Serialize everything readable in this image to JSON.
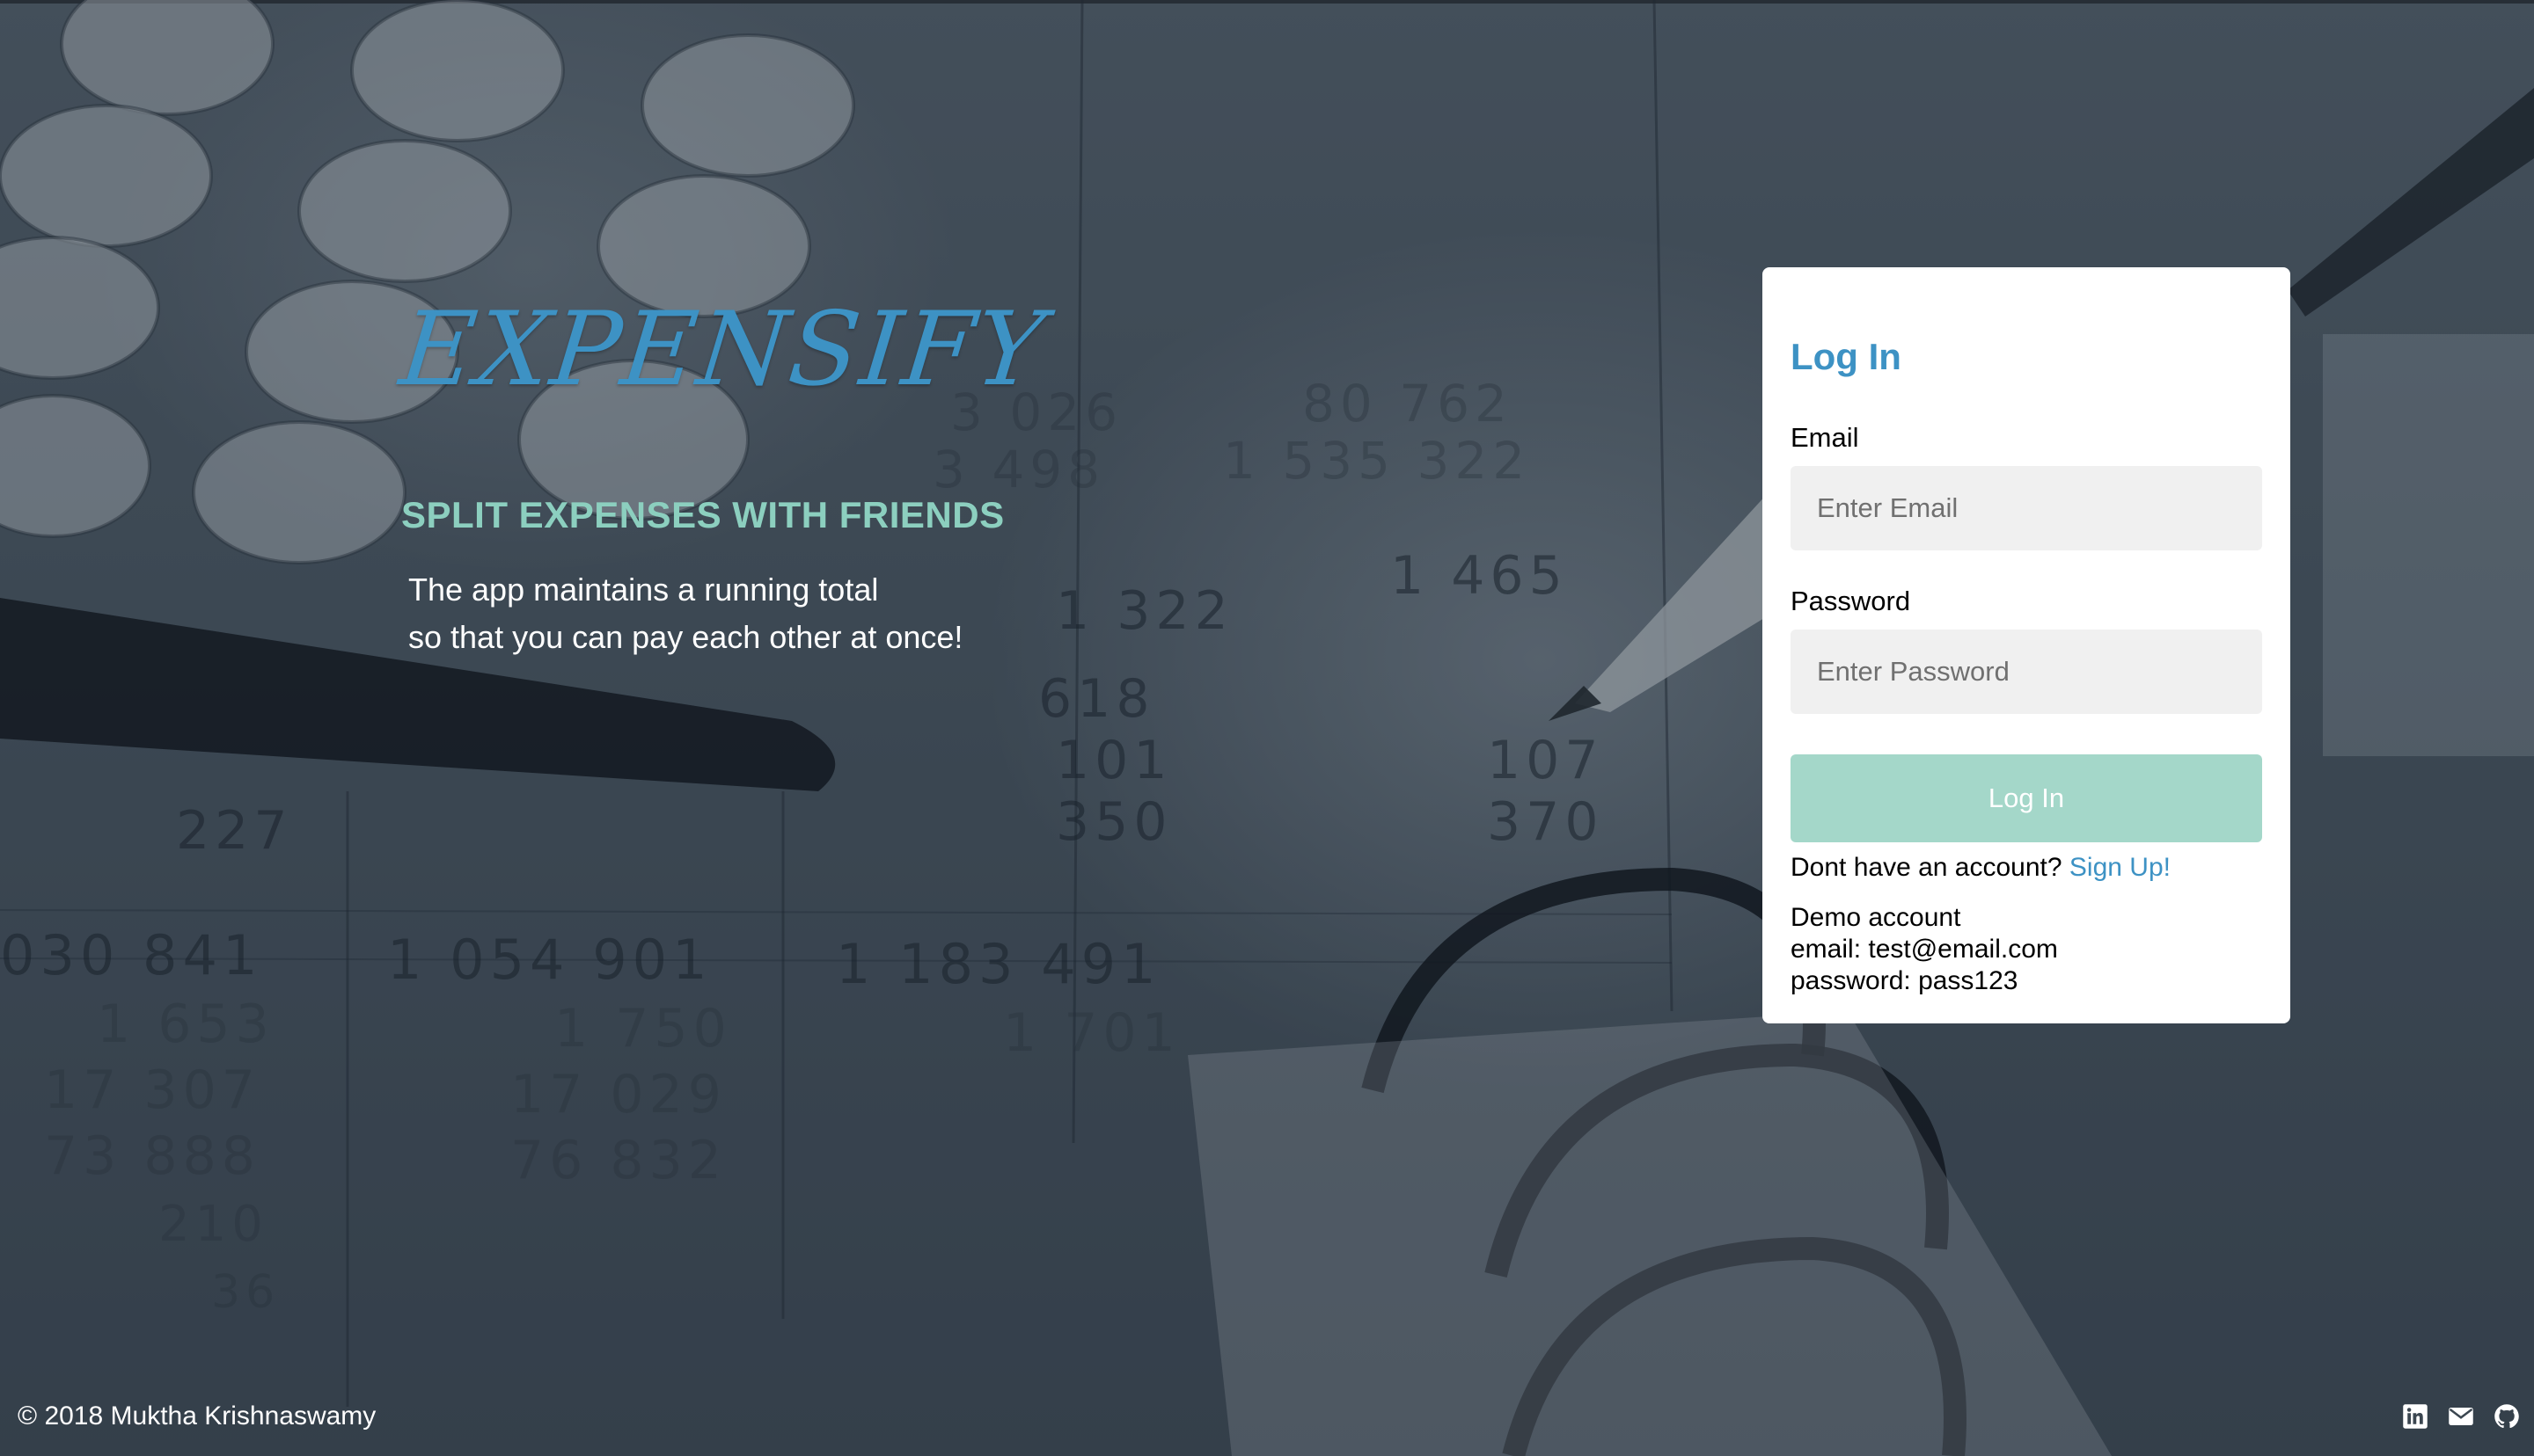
{
  "hero": {
    "logo": "EXPENSIFY",
    "tagline": "SPLIT EXPENSES WITH FRIENDS",
    "description_line1": "The app maintains a running total",
    "description_line2": "so that you can pay each other at once!"
  },
  "login": {
    "title": "Log In",
    "email_label": "Email",
    "email_placeholder": "Enter Email",
    "email_value": "",
    "password_label": "Password",
    "password_placeholder": "Enter Password",
    "password_value": "",
    "button_label": "Log In",
    "signup_prompt": "Dont have an account?",
    "signup_link": "Sign Up!",
    "demo_heading": "Demo account",
    "demo_email": "email: test@email.com",
    "demo_password": "password: pass123"
  },
  "footer": {
    "copyright": "© 2018 Muktha Krishnaswamy",
    "icons": [
      "linkedin-icon",
      "mail-icon",
      "github-icon"
    ]
  },
  "colors": {
    "brand_blue": "#3d92c4",
    "tagline_teal": "#8ccfbf",
    "button_teal": "#a4d7c9",
    "input_bg": "#f0f0f0"
  }
}
